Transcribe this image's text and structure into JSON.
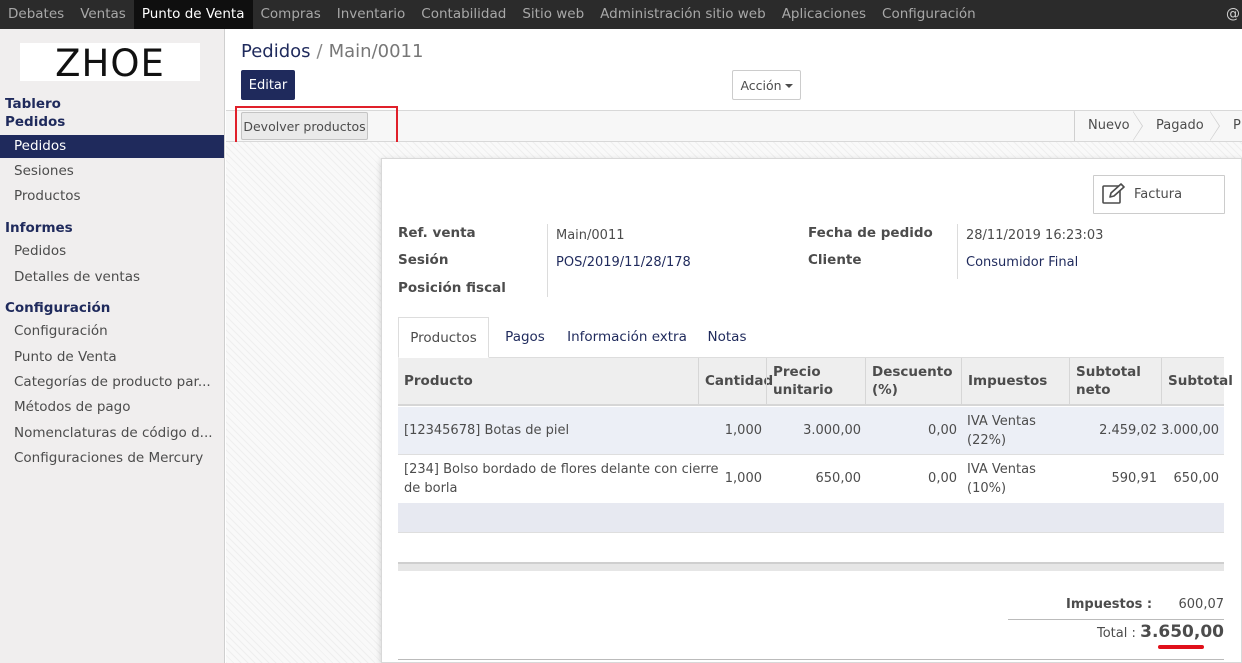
{
  "topmenu": {
    "items": [
      "Debates",
      "Ventas",
      "Punto de Venta",
      "Compras",
      "Inventario",
      "Contabilidad",
      "Sitio web",
      "Administración sitio web",
      "Aplicaciones",
      "Configuración"
    ],
    "active_index": 2,
    "user_icon": "@"
  },
  "logo": {
    "text": "ZHOE"
  },
  "sidebar": {
    "sections": [
      {
        "title": "Tablero"
      },
      {
        "title": "Pedidos",
        "items": [
          "Pedidos",
          "Sesiones",
          "Productos"
        ]
      },
      {
        "title": "Informes",
        "items": [
          "Pedidos",
          "Detalles de ventas"
        ]
      },
      {
        "title": "Configuración",
        "items": [
          "Configuración",
          "Punto de Venta",
          "Categorías de producto par...",
          "Métodos de pago",
          "Nomenclaturas de código d...",
          "Configuraciones de Mercury"
        ]
      }
    ],
    "active_item": "Pedidos"
  },
  "breadcrumb": {
    "parent": "Pedidos",
    "separator": "/",
    "current": "Main/0011"
  },
  "buttons": {
    "edit": "Editar",
    "action": "Acción",
    "return_products": "Devolver productos",
    "invoice": "Factura"
  },
  "statusbar": {
    "stages": [
      "Nuevo",
      "Pagado",
      "P"
    ]
  },
  "form": {
    "ref_label": "Ref. venta",
    "ref_value": "Main/0011",
    "session_label": "Sesión",
    "session_value": "POS/2019/11/28/178",
    "fiscal_label": "Posición fiscal",
    "date_label": "Fecha de pedido",
    "date_value": "28/11/2019 16:23:03",
    "client_label": "Cliente",
    "client_value": "Consumidor Final"
  },
  "tabs": [
    "Productos",
    "Pagos",
    "Información extra",
    "Notas"
  ],
  "active_tab": "Productos",
  "table": {
    "headers": {
      "product": "Producto",
      "qty": "Cantidad",
      "price_1": "Precio",
      "price_2": "unitario",
      "discount_1": "Descuento",
      "discount_2": "(%)",
      "taxes": "Impuestos",
      "subtotal_net_1": "Subtotal",
      "subtotal_net_2": "neto",
      "subtotal": "Subtotal"
    },
    "rows": [
      {
        "product_1": "[12345678] Botas de piel",
        "product_2": "",
        "qty": "1,000",
        "price": "3.000,00",
        "discount": "0,00",
        "taxes_1": "IVA Ventas",
        "taxes_2": "(22%)",
        "subtotal_net": "2.459,02",
        "subtotal": "3.000,00"
      },
      {
        "product_1": "[234] Bolso bordado de flores delante con cierre",
        "product_2": "de borla",
        "qty": "1,000",
        "price": "650,00",
        "discount": "0,00",
        "taxes_1": "IVA Ventas",
        "taxes_2": "(10%)",
        "subtotal_net": "590,91",
        "subtotal": "650,00"
      }
    ]
  },
  "totals": {
    "tax_label": "Impuestos :",
    "tax_value": "600,07",
    "total_label": "Total :",
    "total_value": "3.650,00"
  },
  "colors": {
    "brand": "#1f2a5c",
    "topbar": "#2b2b2b",
    "highlight": "#e0202a"
  }
}
